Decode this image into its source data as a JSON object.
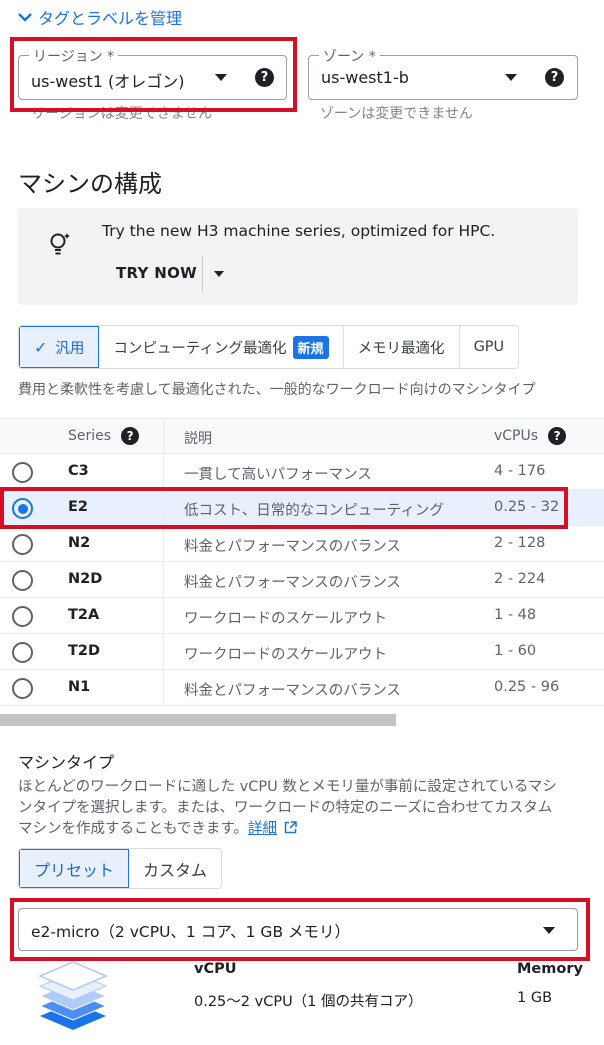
{
  "manage_tags": {
    "label": "タグとラベルを管理"
  },
  "region": {
    "label": "リージョン *",
    "value": "us-west1 (オレゴン)",
    "hint": "リージョンは変更できません"
  },
  "zone": {
    "label": "ゾーン *",
    "value": "us-west1-b",
    "hint": "ゾーンは変更できません"
  },
  "section_title": "マシンの構成",
  "promo": {
    "text": "Try the new H3 machine series, optimized for HPC.",
    "try_now": "TRY NOW"
  },
  "family_tabs": [
    {
      "label": "汎用",
      "active": true
    },
    {
      "label": "コンピューティング最適化",
      "badge": "新規"
    },
    {
      "label": "メモリ最適化"
    },
    {
      "label": "GPU"
    }
  ],
  "family_desc": "費用と柔軟性を考慮して最適化された、一般的なワークロード向けのマシンタイプ",
  "series_table": {
    "headers": {
      "series": "Series",
      "description": "説明",
      "vcpus": "vCPUs"
    },
    "rows": [
      {
        "series": "C3",
        "description": "一貫して高いパフォーマンス",
        "vcpus": "4 - 176",
        "selected": false
      },
      {
        "series": "E2",
        "description": "低コスト、日常的なコンピューティング",
        "vcpus": "0.25 - 32",
        "selected": true
      },
      {
        "series": "N2",
        "description": "料金とパフォーマンスのバランス",
        "vcpus": "2 - 128",
        "selected": false
      },
      {
        "series": "N2D",
        "description": "料金とパフォーマンスのバランス",
        "vcpus": "2 - 224",
        "selected": false
      },
      {
        "series": "T2A",
        "description": "ワークロードのスケールアウト",
        "vcpus": "1 - 48",
        "selected": false
      },
      {
        "series": "T2D",
        "description": "ワークロードのスケールアウト",
        "vcpus": "1 - 60",
        "selected": false
      },
      {
        "series": "N1",
        "description": "料金とパフォーマンスのバランス",
        "vcpus": "0.25 - 96",
        "selected": false
      }
    ]
  },
  "machine_type": {
    "title": "マシンタイプ",
    "desc_line1": "ほとんどのワークロードに適した vCPU 数とメモリ量が事前に設定されているマシ",
    "desc_line2": "ンタイプを選択します。または、ワークロードの特定のニーズに合わせてカスタム",
    "desc_line3": "マシンを作成することもできます。",
    "learn_more": "詳細",
    "tabs": {
      "preset": "プリセット",
      "custom": "カスタム"
    },
    "selected": "e2-micro（2 vCPU、1 コア、1 GB メモリ）",
    "spec": {
      "vcpu_label": "vCPU",
      "vcpu_value": "0.25～2 vCPU（1 個の共有コア）",
      "memory_label": "Memory",
      "memory_value": "1 GB"
    }
  },
  "colors": {
    "accent": "#1a73e8",
    "highlight": "#d50f25"
  }
}
